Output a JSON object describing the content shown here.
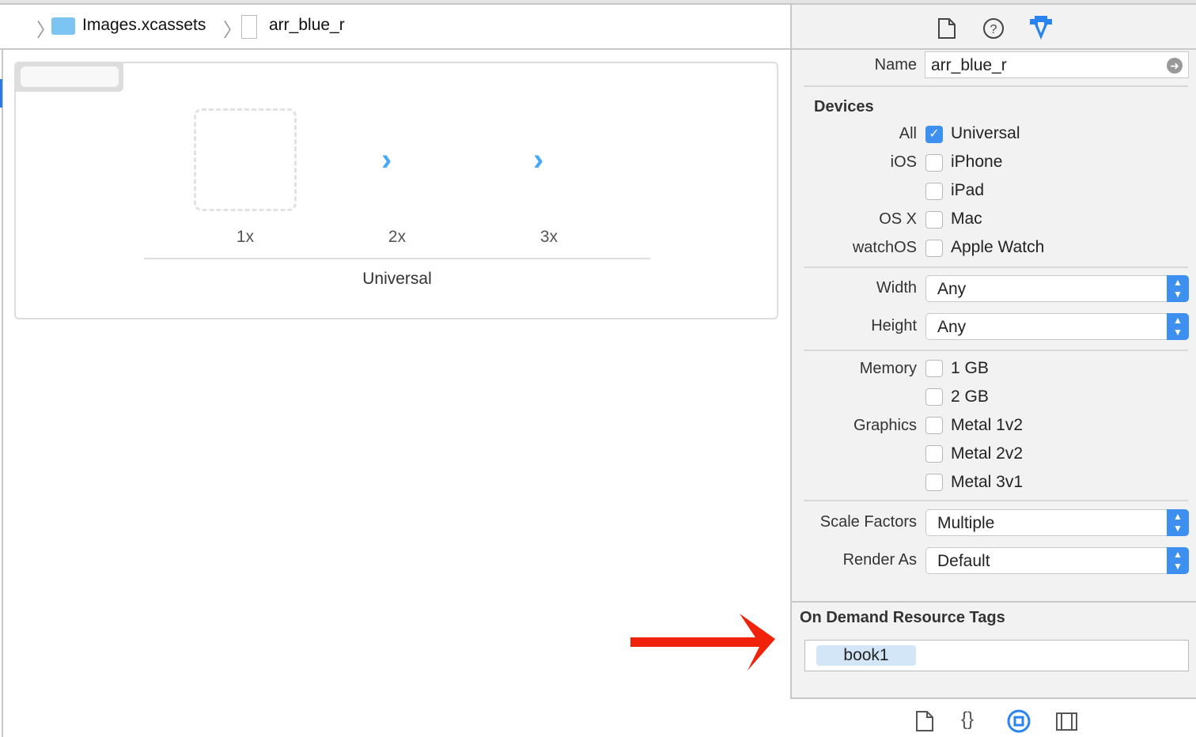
{
  "breadcrumb": {
    "items": [
      "Images.xcassets",
      "arr_blue_r"
    ]
  },
  "asset": {
    "scales": [
      "1x",
      "2x",
      "3x"
    ],
    "device_group": "Universal"
  },
  "inspector": {
    "name_label": "Name",
    "name_value": "arr_blue_r",
    "devices_heading": "Devices",
    "devices": [
      {
        "group": "All",
        "label": "Universal",
        "checked": true
      },
      {
        "group": "iOS",
        "label": "iPhone",
        "checked": false
      },
      {
        "group": "",
        "label": "iPad",
        "checked": false
      },
      {
        "group": "OS X",
        "label": "Mac",
        "checked": false
      },
      {
        "group": "watchOS",
        "label": "Apple Watch",
        "checked": false
      }
    ],
    "width_label": "Width",
    "width_value": "Any",
    "height_label": "Height",
    "height_value": "Any",
    "memory": [
      {
        "group": "Memory",
        "label": "1 GB",
        "checked": false
      },
      {
        "group": "",
        "label": "2 GB",
        "checked": false
      }
    ],
    "graphics": [
      {
        "group": "Graphics",
        "label": "Metal 1v2",
        "checked": false
      },
      {
        "group": "",
        "label": "Metal 2v2",
        "checked": false
      },
      {
        "group": "",
        "label": "Metal 3v1",
        "checked": false
      }
    ],
    "scale_label": "Scale Factors",
    "scale_value": "Multiple",
    "render_label": "Render As",
    "render_value": "Default",
    "odr_heading": "On Demand Resource Tags",
    "tags": [
      "book1"
    ]
  },
  "colors": {
    "accent": "#3d8ff0",
    "annotation_arrow": "#f0220a"
  }
}
